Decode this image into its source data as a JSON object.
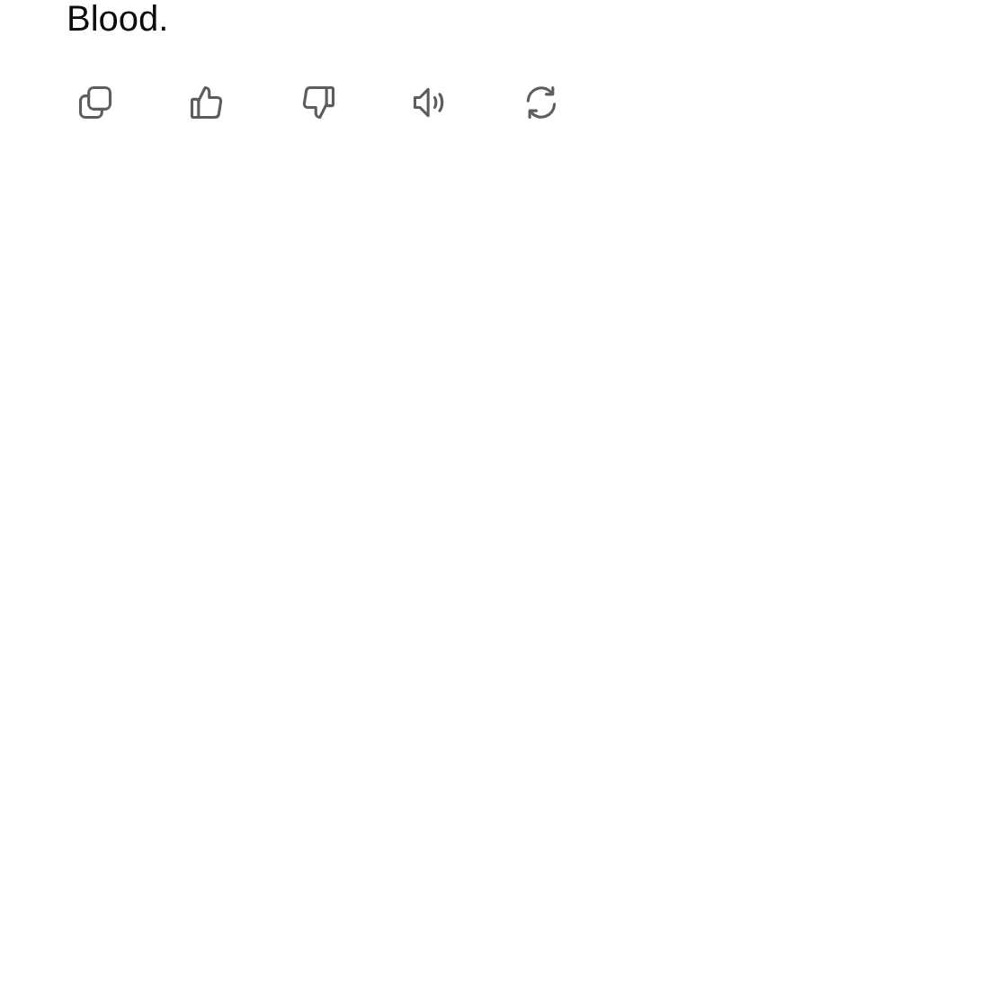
{
  "message": {
    "text": "Blood."
  },
  "actions": [
    {
      "kind": "copy"
    },
    {
      "kind": "like"
    },
    {
      "kind": "dislike"
    },
    {
      "kind": "read-aloud"
    },
    {
      "kind": "regenerate"
    }
  ]
}
